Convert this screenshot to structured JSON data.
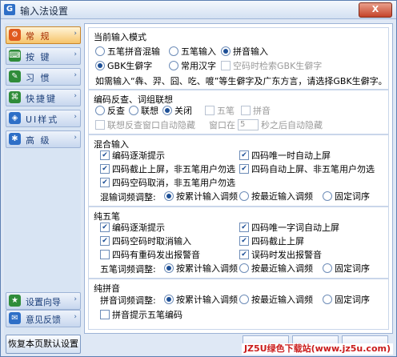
{
  "window": {
    "title": "输入法设置",
    "close_label": "X",
    "app_icon": "G"
  },
  "sidebar": {
    "items": [
      {
        "label": "常 规",
        "icon": "general-icon",
        "color": "#e05a1e",
        "glyph": "⚙"
      },
      {
        "label": "按 键",
        "icon": "keyboard-icon",
        "color": "#2f8c3a",
        "glyph": "⌨"
      },
      {
        "label": "习 惯",
        "icon": "habit-icon",
        "color": "#2f8c3a",
        "glyph": "✎"
      },
      {
        "label": "快捷键",
        "icon": "hotkey-icon",
        "color": "#2f8c3a",
        "glyph": "⌘"
      },
      {
        "label": "UI样式",
        "icon": "skin-icon",
        "color": "#2e6fc7",
        "glyph": "◈"
      },
      {
        "label": "高 级",
        "icon": "advanced-icon",
        "color": "#2e6fc7",
        "glyph": "✱"
      }
    ],
    "bottom_items": [
      {
        "label": "设置向导",
        "icon": "wizard-icon",
        "color": "#2f8c3a",
        "glyph": "★"
      },
      {
        "label": "意见反馈",
        "icon": "feedback-icon",
        "color": "#2e6fc7",
        "glyph": "✉"
      }
    ],
    "reset_label": "恢复本页默认设置"
  },
  "current_mode": {
    "title": "当前输入模式",
    "modes": [
      "五笔拼音混输",
      "五笔输入",
      "拼音输入"
    ],
    "selected_mode": "拼音输入",
    "charsets": [
      "GBK生僻字",
      "常用汉字"
    ],
    "selected_charset": "GBK生僻字",
    "gbk_check": "空码时检索GBK生僻字",
    "note": "如需输入“犇、羿、囧、吃、喥”等生僻字及广东方言，请选择GBK生僻字。"
  },
  "reverse": {
    "title": "编码反查、词组联想",
    "options": [
      "反查",
      "联想",
      "关闭"
    ],
    "selected": "关闭",
    "wubi": "五笔",
    "pinyin": "拼音",
    "autohide_label": "联想反查窗口自动隐藏",
    "window_label": "窗口在",
    "seconds_value": "5",
    "seconds_suffix": "秒之后自动隐藏"
  },
  "mixed": {
    "title": "混合输入",
    "checks": [
      "编码逐渐提示",
      "四码唯一时自动上屏",
      "四码截止上屏，非五笔用户勿选",
      "四码自动上屏、非五笔用户勿选",
      "四码空码取消，非五笔用户勿选"
    ],
    "order_label": "混输词频调整:",
    "order_options": [
      "按累计输入调频",
      "按最近输入调频",
      "固定词序"
    ],
    "selected_order": "按累计输入调频"
  },
  "pure_wubi": {
    "title": "纯五笔",
    "checks": [
      "编码逐渐提示",
      "四码唯一字词自动上屏",
      "四码空码时取消输入",
      "四码截止上屏",
      "四码有重码发出报警音",
      "误码时发出报警音"
    ],
    "order_label": "五笔词频调整:",
    "order_options": [
      "按累计输入调频",
      "按最近输入调频",
      "固定词序"
    ],
    "selected_order": "按累计输入调频"
  },
  "pure_pinyin": {
    "title": "纯拼音",
    "order_label": "拼音词频调整:",
    "order_options": [
      "按累计输入调频",
      "按最近输入调频",
      "固定词序"
    ],
    "selected_order": "按累计输入调频",
    "hint_check": "拼音提示五笔编码"
  },
  "watermark": "JZ5U绿色下载站(www.jz5u.com)"
}
